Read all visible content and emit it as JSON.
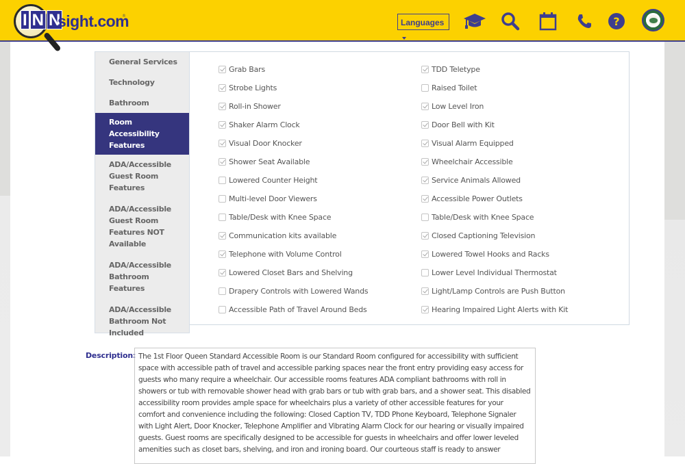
{
  "header": {
    "logo": {
      "inn_letters": [
        "I",
        "N",
        "N"
      ],
      "text": "sight.com",
      "tm": "®"
    },
    "languages_label": "Languages",
    "icons": [
      {
        "name": "graduation-cap-icon"
      },
      {
        "name": "search-icon"
      },
      {
        "name": "calendar-icon"
      },
      {
        "name": "phone-icon"
      },
      {
        "name": "help-icon"
      },
      {
        "name": "seal-logo-icon"
      }
    ],
    "colors": {
      "bar": "#fcd100",
      "accent": "#3e3e8e"
    }
  },
  "sidenav": {
    "active_index": 3,
    "items": [
      {
        "label": "General Services"
      },
      {
        "label": "Technology"
      },
      {
        "label": "Bathroom"
      },
      {
        "label": "Room Accessibility Features"
      },
      {
        "label": "ADA/Accessible Guest Room Features"
      },
      {
        "label": "ADA/Accessible Guest Room Features NOT Available"
      },
      {
        "label": "ADA/Accessible Bathroom Features"
      },
      {
        "label": "ADA/Accessible Bathroom Not Included"
      }
    ]
  },
  "features": {
    "left": [
      {
        "label": "Grab Bars",
        "checked": true
      },
      {
        "label": "Strobe Lights",
        "checked": true
      },
      {
        "label": "Roll-in Shower",
        "checked": true
      },
      {
        "label": "Shaker Alarm Clock",
        "checked": true
      },
      {
        "label": "Visual Door Knocker",
        "checked": true
      },
      {
        "label": "Shower Seat Available",
        "checked": true
      },
      {
        "label": "Lowered Counter Height",
        "checked": false
      },
      {
        "label": "Multi-level Door Viewers",
        "checked": false
      },
      {
        "label": "Table/Desk with Knee Space",
        "checked": false
      },
      {
        "label": "Communication kits available",
        "checked": true
      },
      {
        "label": "Telephone with Volume Control",
        "checked": true
      },
      {
        "label": "Lowered Closet Bars and Shelving",
        "checked": true
      },
      {
        "label": "Drapery Controls with Lowered Wands",
        "checked": false
      },
      {
        "label": "Accessible Path of Travel Around Beds",
        "checked": false
      }
    ],
    "right": [
      {
        "label": "TDD Teletype",
        "checked": true
      },
      {
        "label": "Raised Toilet",
        "checked": false
      },
      {
        "label": "Low Level Iron",
        "checked": true
      },
      {
        "label": "Door Bell with Kit",
        "checked": true
      },
      {
        "label": "Visual Alarm Equipped",
        "checked": true
      },
      {
        "label": "Wheelchair Accessible",
        "checked": true
      },
      {
        "label": "Service Animals Allowed",
        "checked": true
      },
      {
        "label": "Accessible Power Outlets",
        "checked": true
      },
      {
        "label": "Table/Desk with Knee Space",
        "checked": false
      },
      {
        "label": "Closed Captioning Television",
        "checked": true
      },
      {
        "label": "Lowered Towel Hooks and Racks",
        "checked": true
      },
      {
        "label": "Lower Level Individual Thermostat",
        "checked": false
      },
      {
        "label": "Light/Lamp Controls are Push Button",
        "checked": true
      },
      {
        "label": "Hearing Impaired Light Alerts with Kit",
        "checked": true
      }
    ]
  },
  "description": {
    "label": "Description:",
    "text": "The 1st Floor Queen Standard Accessible Room is our Standard Room configured for accessibility with sufficient space with accessible path of travel and accessible parking spaces near the front entry providing easy access for guests who many require a wheelchair. Our accessible rooms features ADA compliant bathrooms with roll in showers or tub with removable shower head with grab bars or tub with grab bars, and a shower seat.  This disabled accessibility room provides ample space for wheelchairs plus a variety of other accessible features for your comfort and convenience including the following: Closed Caption TV, TDD Phone Keyboard, Telephone Signaler with Light Alert, Door Knocker, Telephone Amplifier and Vibrating Alarm Clock for our hearing or visually impaired guests.  Guest rooms are specifically designed to be accessible for guests in wheelchairs and offer lower leveled amenities such as closet bars, shelving, and iron and ironing board. Our courteous staff is ready to answer"
  }
}
